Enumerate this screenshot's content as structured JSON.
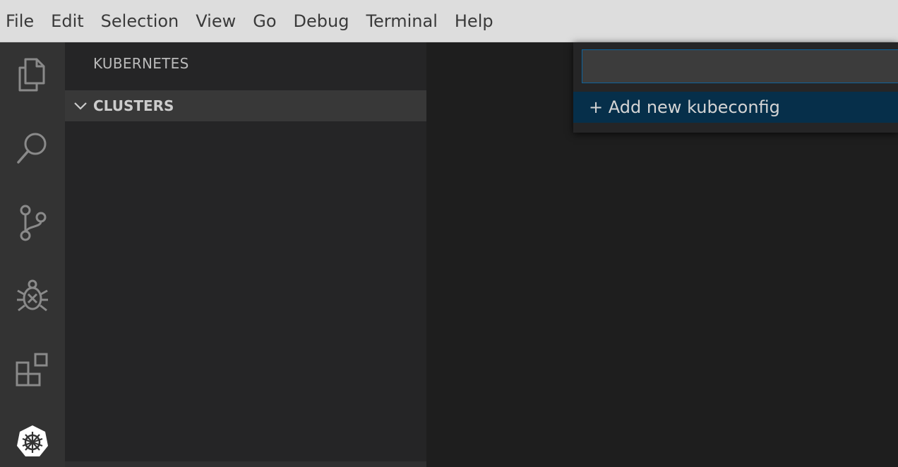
{
  "menu": {
    "items": [
      "File",
      "Edit",
      "Selection",
      "View",
      "Go",
      "Debug",
      "Terminal",
      "Help"
    ]
  },
  "activity_bar": {
    "icons": [
      "explorer-icon",
      "search-icon",
      "source-control-icon",
      "debug-icon",
      "extensions-icon",
      "kubernetes-icon"
    ],
    "active": "kubernetes-icon"
  },
  "sidebar": {
    "title": "KUBERNETES",
    "sections": [
      {
        "label": "CLUSTERS",
        "expanded": true,
        "chevron_icon": "chevron-down-icon"
      }
    ]
  },
  "quick_pick": {
    "input_value": "",
    "placeholder": "",
    "items": [
      {
        "label": "+ Add new kubeconfig",
        "selected": true
      }
    ]
  },
  "colors": {
    "menubar_bg": "#dddddd",
    "activity_bar_bg": "#333333",
    "sidebar_bg": "#252526",
    "section_header_bg": "#383838",
    "editor_bg": "#1e1e1e",
    "quick_pick_selected_bg": "#062f4a",
    "focus_border": "#0e639c",
    "kubernetes_badge": "#ffffff"
  }
}
